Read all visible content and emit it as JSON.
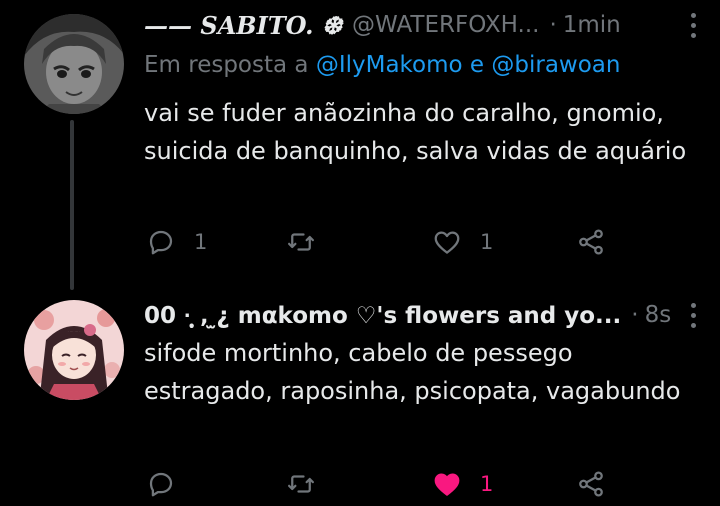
{
  "tweets": [
    {
      "display_name": "—— SABITO. ❆",
      "handle": "@WATERFOXH...",
      "separator": "·",
      "time": "1min",
      "reply_prefix": "Em resposta a",
      "reply_mentions": "@IlyMakomo e @birawoan",
      "text": "vai se fuder anãozinha do caralho, gnomio, suicida de banquinho, salva vidas de aquário",
      "replies": "1",
      "retweets": "",
      "likes": "1",
      "liked": false,
      "avatar_icon": "grayscale-anime-avatar"
    },
    {
      "display_name": "00 ·̩̩̥͙ ‚ ̫¿ mαkomo ♡'s flowers and yo...",
      "separator": "·",
      "time": "8s",
      "text": "sifode mortinho, cabelo de pessego estragado, raposinha, psicopata, vagabundo",
      "replies": "",
      "retweets": "",
      "likes": "1",
      "liked": true,
      "avatar_icon": "pink-anime-avatar"
    }
  ],
  "colors": {
    "background": "#000000",
    "text": "#e7e9ea",
    "secondary": "#71767b",
    "link": "#1d9bf0",
    "like": "#f91880",
    "thread_line": "#333639"
  }
}
